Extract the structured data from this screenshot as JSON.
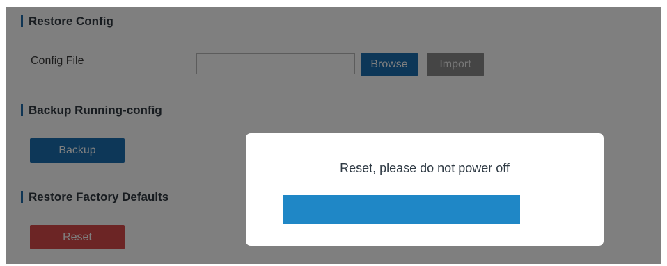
{
  "sections": {
    "restore_config": {
      "title": "Restore Config",
      "config_file_label": "Config File",
      "file_value": "",
      "browse_label": "Browse",
      "import_label": "Import"
    },
    "backup": {
      "title": "Backup Running-config",
      "backup_label": "Backup"
    },
    "factory": {
      "title": "Restore Factory Defaults",
      "reset_label": "Reset"
    }
  },
  "modal": {
    "message": "Reset, please do not power off",
    "progress": 1.0
  },
  "colors": {
    "primary": "#1a6fb1",
    "danger": "#d84a4a",
    "disabled": "#8a8a8a",
    "progress": "#1f87c6",
    "overlay": "rgba(0,0,0,0.5)"
  }
}
